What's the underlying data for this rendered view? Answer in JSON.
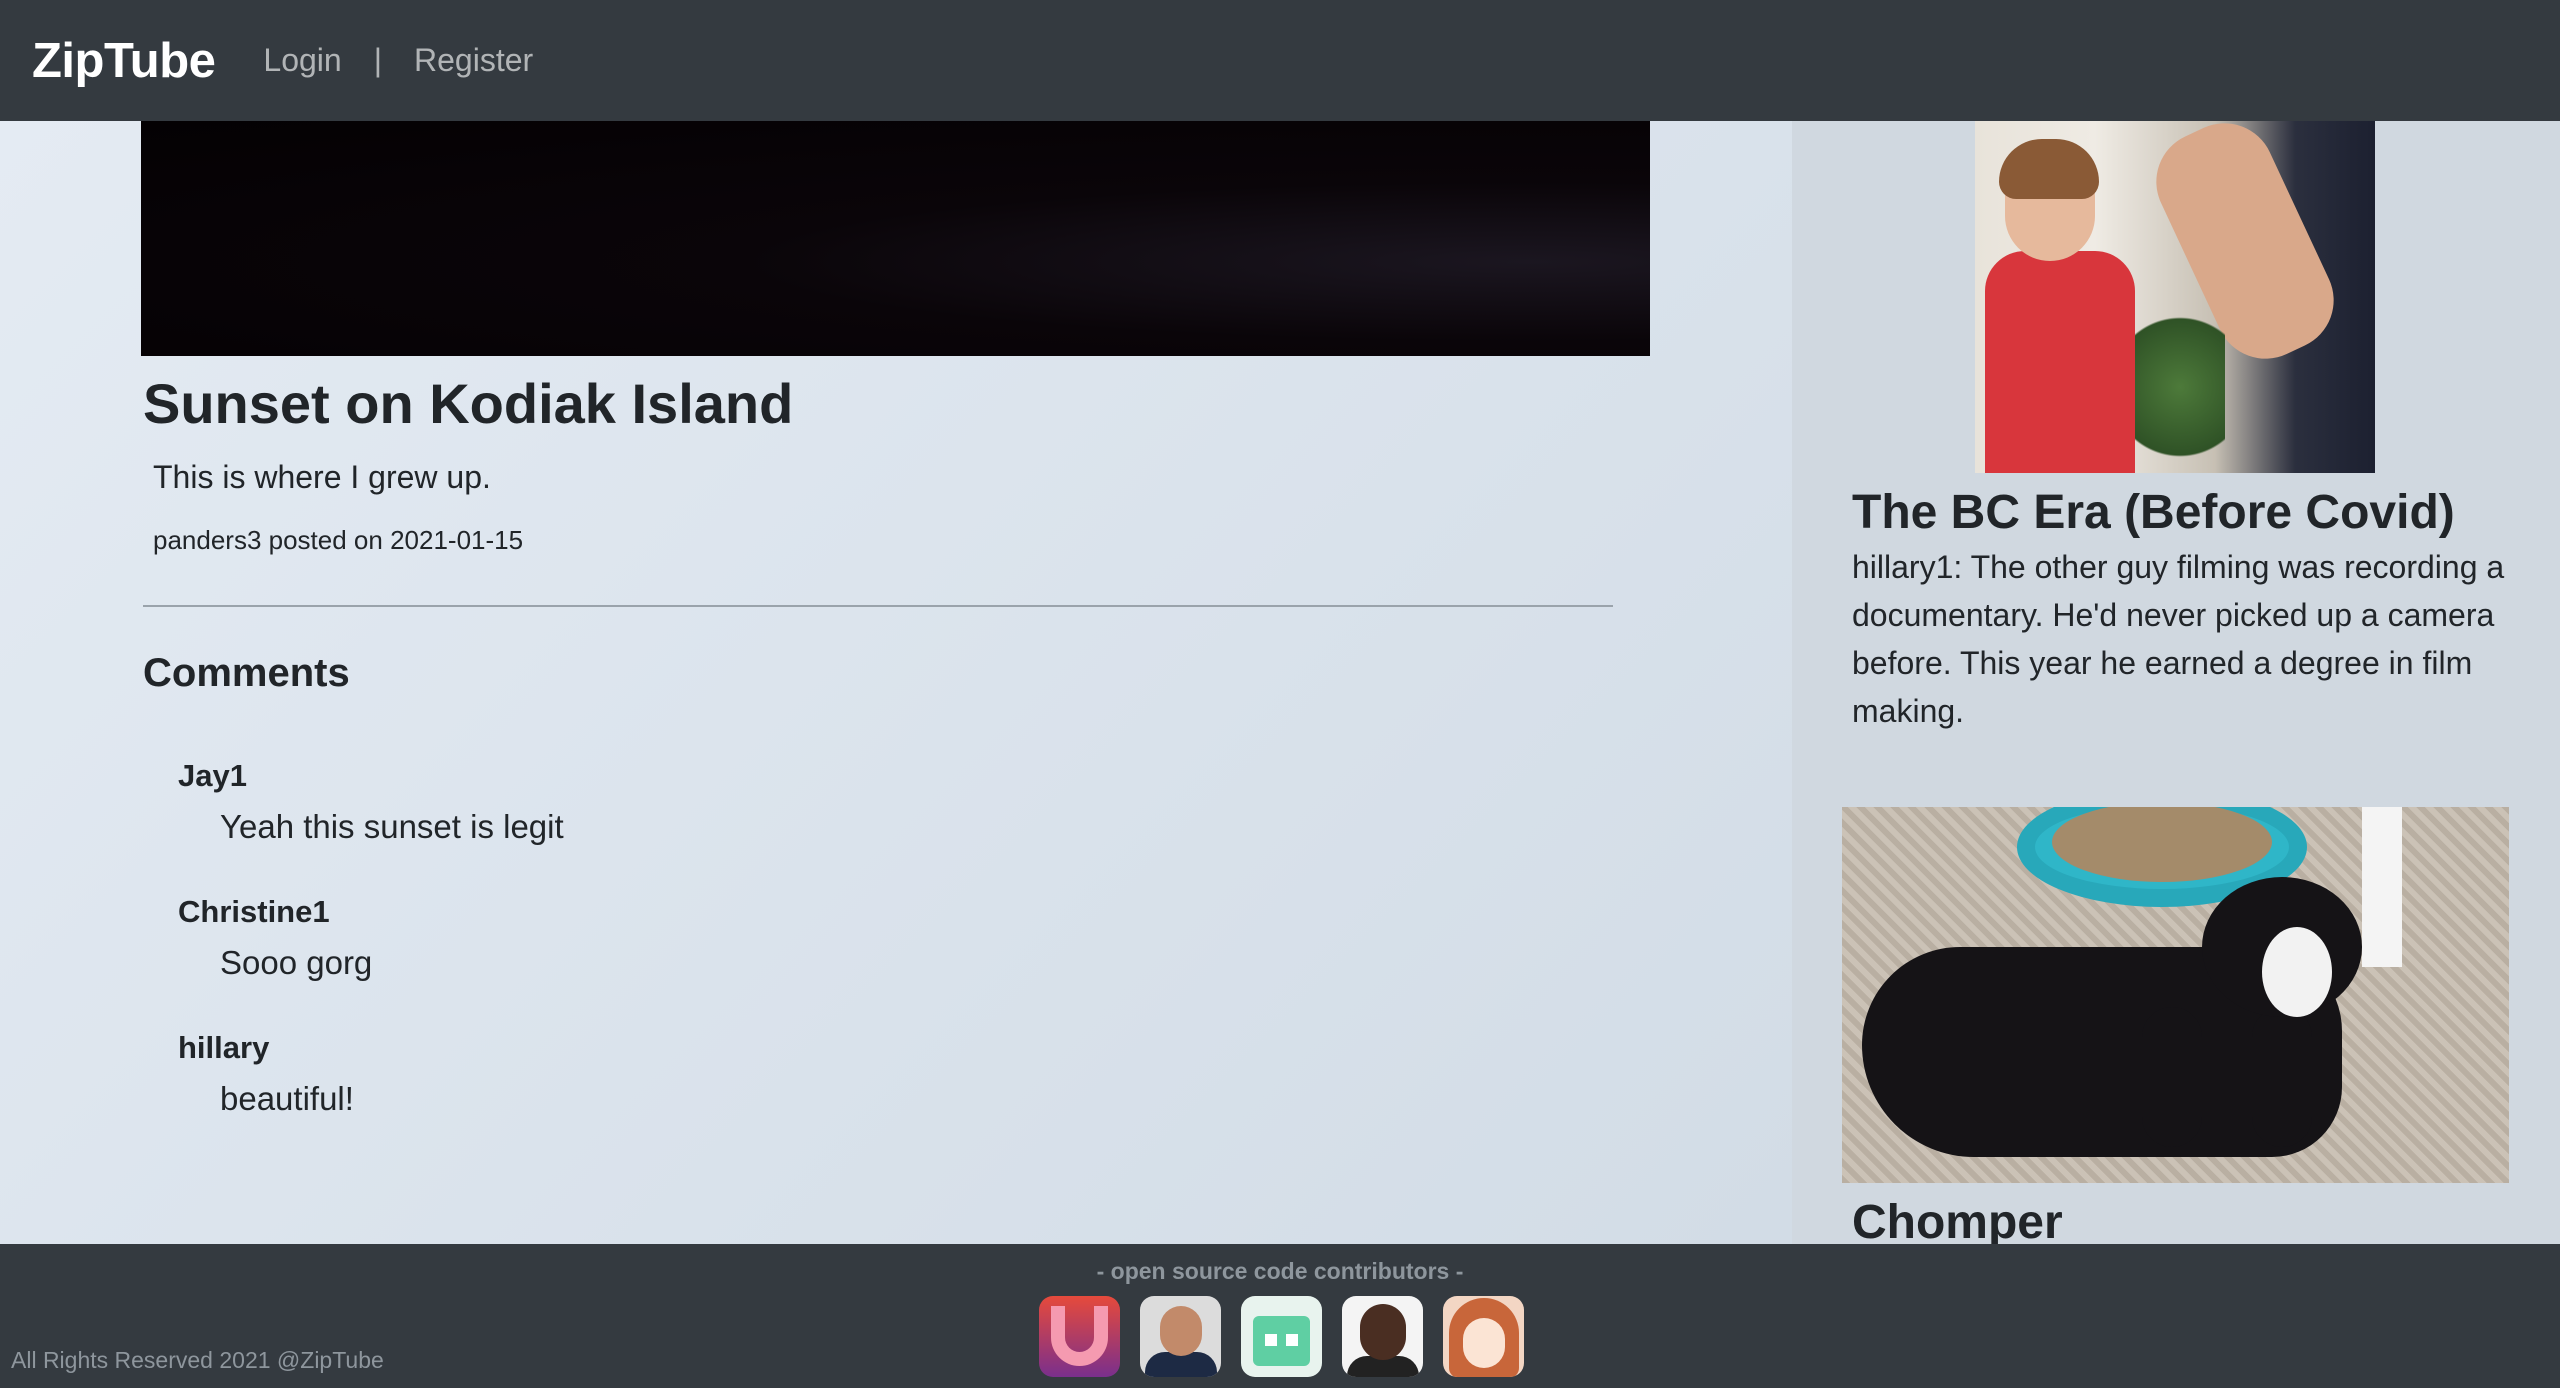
{
  "navbar": {
    "brand": "ZipTube",
    "login": "Login",
    "separator": "|",
    "register": "Register"
  },
  "video": {
    "title": "Sunset on Kodiak Island",
    "description": "This is where I grew up.",
    "meta": "panders3 posted on 2021-01-15"
  },
  "comments": {
    "heading": "Comments",
    "items": [
      {
        "author": "Jay1",
        "text": "Yeah this sunset is legit"
      },
      {
        "author": "Christine1",
        "text": "Sooo gorg"
      },
      {
        "author": "hillary",
        "text": "beautiful!"
      }
    ]
  },
  "sidebar": {
    "videos": [
      {
        "title": "The BC Era (Before Covid)",
        "description": "hillary1: The other guy filming was recording a documentary. He'd never picked up a camera before. This year he earned a degree in film making."
      },
      {
        "title": "Chomper"
      }
    ]
  },
  "footer": {
    "contributors_label": "-  open source code contributors -",
    "copyright": "All Rights Reserved 2021 @ZipTube"
  },
  "colors": {
    "navbar_bg": "#343a40",
    "main_bg": "#dce4ec",
    "sidebar_bg": "#d0d8e0"
  }
}
